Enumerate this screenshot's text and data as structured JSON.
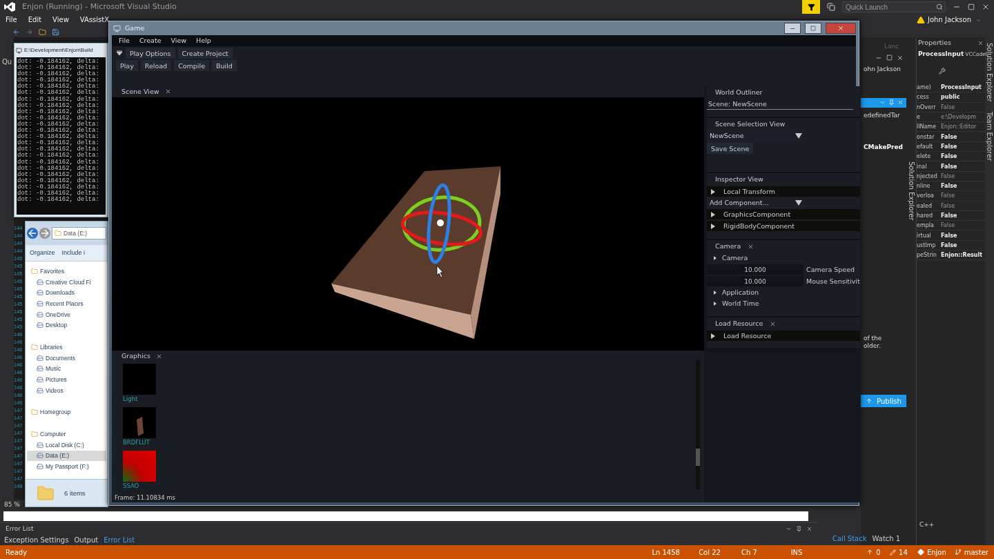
{
  "vs": {
    "title": "Enjon (Running) - Microsoft Visual Studio",
    "menu": [
      "File",
      "Edit",
      "View",
      "VAssistX"
    ],
    "quick_launch": {
      "placeholder": "Quick Launch"
    },
    "user": "John Jackson",
    "side_label": "Qu",
    "line_numbers": [
      "144",
      "144",
      "144",
      "144",
      "145",
      "145",
      "145",
      "145",
      "145",
      "145",
      "145",
      "145",
      "145",
      "145",
      "146",
      "146",
      "146",
      "146",
      "146",
      "146",
      "146",
      "146",
      "146",
      "146",
      "147",
      "147",
      "147",
      "147",
      "147",
      "147",
      "147",
      "147",
      "147",
      "147",
      "148"
    ],
    "zoom": "85 %",
    "floating_panel": {
      "tab": "Lanc",
      "user": "ohn Jackson",
      "target": "edefinedTar",
      "item": "CMakePred",
      "note": [
        "of the",
        "older."
      ],
      "publish": "Publish"
    },
    "properties": {
      "title": "Properties",
      "object": "ProcessInput",
      "object_type": "VCCodel",
      "rows": [
        {
          "name": "ame)",
          "value": "ProcessInput",
          "dimmed": false
        },
        {
          "name": "cess",
          "value": "public",
          "dimmed": false
        },
        {
          "name": "nOverr",
          "value": "False",
          "dimmed": true
        },
        {
          "name": "e",
          "value": "e:\\Developm",
          "dimmed": true
        },
        {
          "name": "llName",
          "value": "Enjon::Editor",
          "dimmed": true
        },
        {
          "name": "onstar",
          "value": "False",
          "dimmed": false
        },
        {
          "name": "efault",
          "value": "False",
          "dimmed": false
        },
        {
          "name": "elete",
          "value": "False",
          "dimmed": false
        },
        {
          "name": "inal",
          "value": "False",
          "dimmed": false
        },
        {
          "name": "njected",
          "value": "False",
          "dimmed": true
        },
        {
          "name": "nline",
          "value": "False",
          "dimmed": false
        },
        {
          "name": "verloa",
          "value": "False",
          "dimmed": true
        },
        {
          "name": "ealed",
          "value": "False",
          "dimmed": true
        },
        {
          "name": "hared",
          "value": "False",
          "dimmed": false
        },
        {
          "name": "empla",
          "value": "False",
          "dimmed": true
        },
        {
          "name": "irtual",
          "value": "False",
          "dimmed": false
        },
        {
          "name": "ustImp",
          "value": "False",
          "dimmed": false
        },
        {
          "name": "peStrin",
          "value": "Enjon::Result",
          "dimmed": false
        }
      ]
    },
    "side_tabs": [
      "Solution Explorer",
      "Team Explorer"
    ],
    "inner_tab": "Solution Explorer",
    "language": "C++",
    "debug_tabs": [
      {
        "label": "Call Stack",
        "selected": true
      },
      {
        "label": "Watch 1",
        "selected": false
      }
    ],
    "error_list": {
      "title": "Error List",
      "tabs": [
        {
          "label": "Exception Settings",
          "selected": false
        },
        {
          "label": "Output",
          "selected": false
        },
        {
          "label": "Error List",
          "selected": true
        }
      ]
    },
    "status_bar": {
      "state": "Ready",
      "line": "Ln 1458",
      "col": "Col 22",
      "ch": "Ch 7",
      "mode": "INS",
      "pushes": "0",
      "changes": "14",
      "repo": "Enjon",
      "branch": "master"
    }
  },
  "console": {
    "title": "E:\\Development\\Enjon\\Build",
    "lines": [
      "dot: -0.184162, delta:",
      "dot: -0.184162, delta:",
      "dot: -0.184162, delta:",
      "dot: -0.184162, delta:",
      "dot: -0.184162, delta:",
      "dot: -0.184162, delta:",
      "dot: -0.184162, delta:",
      "dot: -0.184162, delta:",
      "dot: -0.184162, delta:",
      "dot: -0.184162, delta:",
      "dot: -0.184162, delta:",
      "dot: -0.184162, delta:",
      "dot: -0.184162, delta:",
      "dot: -0.184162, delta:",
      "dot: -0.184162, delta:",
      "dot: -0.184162, delta:",
      "dot: -0.184162, delta:",
      "dot: -0.184162, delta:",
      "dot: -0.184162, delta:",
      "dot: -0.184162, delta:",
      "dot: -0.184162, delta:",
      "dot: -0.184162, delta:",
      "dot: -0.184162, delta:"
    ]
  },
  "explorer": {
    "path": "Data (E:)",
    "toolbar": [
      "Organize",
      "Include i"
    ],
    "tree": [
      {
        "label": "Favorites",
        "selected": false,
        "children": [
          {
            "label": "Creative Cloud Fi",
            "selected": false
          },
          {
            "label": "Downloads",
            "selected": false
          },
          {
            "label": "Recent Places",
            "selected": false
          },
          {
            "label": "OneDrive",
            "selected": false
          },
          {
            "label": "Desktop",
            "selected": false
          }
        ]
      },
      {
        "label": "Libraries",
        "selected": false,
        "children": [
          {
            "label": "Documents",
            "selected": false
          },
          {
            "label": "Music",
            "selected": false
          },
          {
            "label": "Pictures",
            "selected": false
          },
          {
            "label": "Videos",
            "selected": false
          }
        ]
      },
      {
        "label": "Homegroup",
        "selected": false
      },
      {
        "label": "Computer",
        "selected": false,
        "children": [
          {
            "label": "Local Disk (C:)",
            "selected": false
          },
          {
            "label": "Data (E:)",
            "selected": true
          },
          {
            "label": "My Passport (F:)",
            "selected": false
          }
        ]
      }
    ],
    "footer": "6 items"
  },
  "game": {
    "title": "Game",
    "menu": [
      "File",
      "Create",
      "View",
      "Help"
    ],
    "toolbar_top": [
      "Play Options",
      "Create Project"
    ],
    "toolbar_bottom": [
      "Play",
      "Reload",
      "Compile",
      "Build"
    ],
    "scene_tab": "Scene View",
    "graphics_tab": "Graphics",
    "textures": [
      {
        "name": "Light",
        "kind": "black"
      },
      {
        "name": "BRDFLUT",
        "kind": "lut"
      },
      {
        "name": "SSAO",
        "kind": "red"
      }
    ],
    "frame": "Frame: 11.10834 ms",
    "world_outliner": {
      "title": "World Outliner",
      "scene": "Scene: NewScene"
    },
    "scene_selection": {
      "title": "Scene Selection View",
      "dropdown": "NewScene",
      "button": "Save Scene"
    },
    "panels": [
      {
        "title": "Inspector View",
        "closable": false,
        "items": [
          {
            "kind": "section",
            "label": "Local Transform"
          },
          {
            "kind": "dropdown",
            "label": "Add Component..."
          },
          {
            "kind": "section",
            "label": "GraphicsComponent"
          },
          {
            "kind": "section",
            "label": "RigidBodyComponent"
          }
        ]
      },
      {
        "title": "Camera",
        "closable": true,
        "items": [
          {
            "kind": "tree",
            "label": "Camera"
          },
          {
            "kind": "field",
            "value": "10.000",
            "caption": "Camera Speed"
          },
          {
            "kind": "field",
            "value": "10.000",
            "caption": "Mouse Sensitivit"
          },
          {
            "kind": "tree",
            "label": "Application"
          },
          {
            "kind": "tree",
            "label": "World Time"
          }
        ]
      },
      {
        "title": "Load Resource",
        "closable": true,
        "items": [
          {
            "kind": "section",
            "label": "Load Resource"
          }
        ]
      }
    ]
  }
}
